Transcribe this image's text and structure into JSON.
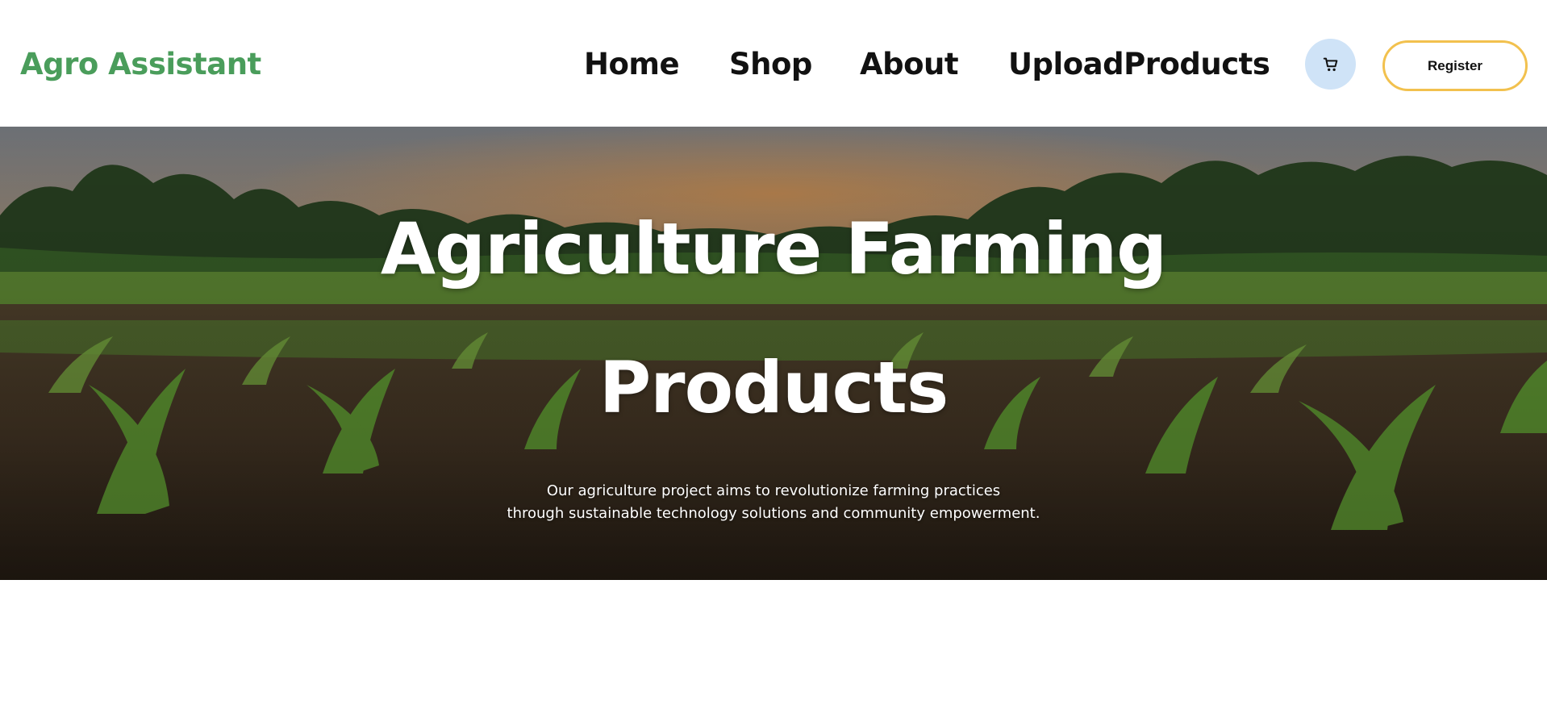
{
  "navbar": {
    "brand": "Agro Assistant",
    "links": [
      "Home",
      "Shop",
      "About",
      "UploadProducts"
    ],
    "cart_icon": "cart-icon",
    "register_label": "Register"
  },
  "hero": {
    "title_line1": "Agriculture Farming",
    "title_line2": "Products",
    "description_line1": "Our agriculture project aims to revolutionize farming practices",
    "description_line2": "through sustainable technology solutions and community empowerment."
  },
  "colors": {
    "brand": "#4a9d5b",
    "register_border": "#f2c14e",
    "cart_bg": "#cfe3f7"
  }
}
